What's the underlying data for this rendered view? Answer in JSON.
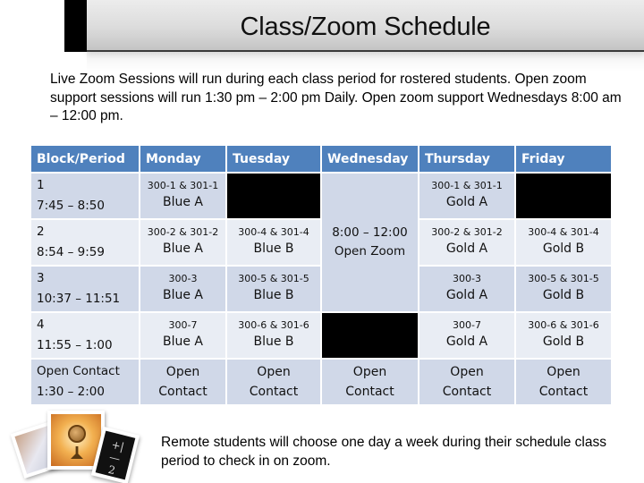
{
  "title": "Class/Zoom Schedule",
  "intro": "Live Zoom Sessions will run during each class period for rostered students. Open zoom support sessions will run 1:30 pm – 2:00 pm Daily.  Open zoom support Wednesdays 8:00 am – 12:00 pm.",
  "table": {
    "headers": [
      "Block/Period",
      "Monday",
      "Tuesday",
      "Wednesday",
      "Thursday",
      "Friday"
    ],
    "rows": [
      {
        "block": "1",
        "time": "7:45 – 8:50",
        "monday": {
          "code": "300-1 & 301-1",
          "group": "Blue A"
        },
        "tuesday": null,
        "thursday": {
          "code": "300-1 & 301-1",
          "group": "Gold A"
        },
        "friday": null
      },
      {
        "block": "2",
        "time": "8:54 – 9:59",
        "monday": {
          "code": "300-2 & 301-2",
          "group": "Blue A"
        },
        "tuesday": {
          "code": "300-4 & 301-4",
          "group": "Blue B"
        },
        "thursday": {
          "code": "300-2 & 301-2",
          "group": "Gold A"
        },
        "friday": {
          "code": "300-4 & 301-4",
          "group": "Gold B"
        }
      },
      {
        "block": "3",
        "time": "10:37 – 11:51",
        "monday": {
          "code": "300-3",
          "group": "Blue A"
        },
        "tuesday": {
          "code": "300-5 & 301-5",
          "group": "Blue B"
        },
        "thursday": {
          "code": "300-3",
          "group": "Gold A"
        },
        "friday": {
          "code": "300-5 & 301-5",
          "group": "Gold B"
        }
      },
      {
        "block": "4",
        "time": "11:55 – 1:00",
        "monday": {
          "code": "300-7",
          "group": "Blue A"
        },
        "tuesday": {
          "code": "300-6 & 301-6",
          "group": "Blue B"
        },
        "wednesday_blocked": true,
        "thursday": {
          "code": "300-7",
          "group": "Gold A"
        },
        "friday": {
          "code": "300-6 & 301-6",
          "group": "Gold B"
        }
      }
    ],
    "wednesday_morning": {
      "time": "8:00 – 12:00",
      "label": "Open Zoom"
    },
    "open_contact_row": {
      "block": "Open Contact",
      "time": "1:30 – 2:00",
      "cell_line1": "Open",
      "cell_line2": "Contact"
    }
  },
  "footer_note": "Remote students will choose one day a week during their schedule class period to check in on zoom.",
  "photo_right_chalk": "+|\n–\n2",
  "colors": {
    "header_bg": "#4f81bd",
    "row_dark": "#d0d8e8",
    "row_light": "#e9edf4",
    "blocked": "#000000"
  }
}
